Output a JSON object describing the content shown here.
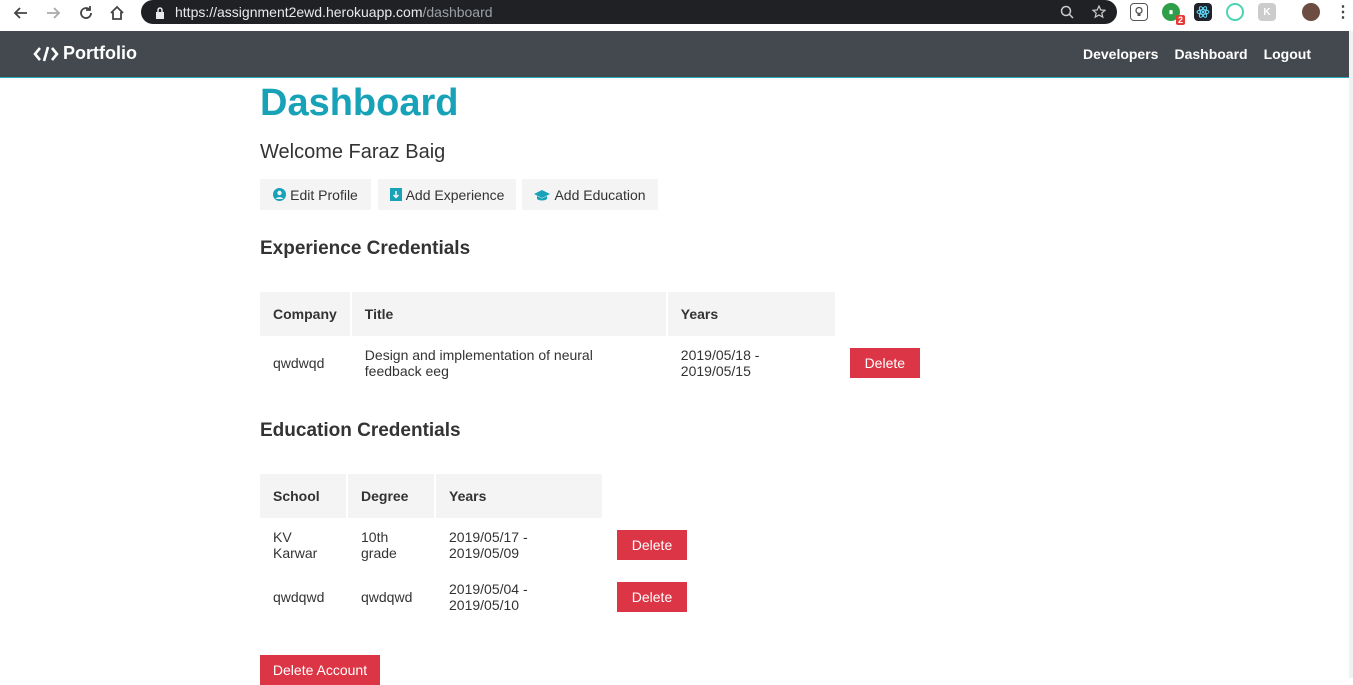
{
  "browser": {
    "url_main": "https://assignment2ewd.herokuapp.com",
    "url_path": "/dashboard",
    "ext_badge": "2"
  },
  "navbar": {
    "brand": "Portfolio",
    "links": [
      "Developers",
      "Dashboard",
      "Logout"
    ]
  },
  "dashboard": {
    "title": "Dashboard",
    "welcome": "Welcome Faraz Baig",
    "actions": {
      "edit_profile": "Edit Profile",
      "add_experience": "Add Experience",
      "add_education": "Add Education"
    }
  },
  "experience": {
    "title": "Experience Credentials",
    "headers": [
      "Company",
      "Title",
      "Years"
    ],
    "rows": [
      {
        "company": "qwdwqd",
        "title": "Design and implementation of neural feedback eeg",
        "years": "2019/05/18 - 2019/05/15",
        "action": "Delete"
      }
    ]
  },
  "education": {
    "title": "Education Credentials",
    "headers": [
      "School",
      "Degree",
      "Years"
    ],
    "rows": [
      {
        "school": "KV Karwar",
        "degree": "10th grade",
        "years": "2019/05/17 - 2019/05/09",
        "action": "Delete"
      },
      {
        "school": "qwdqwd",
        "degree": "qwdqwd",
        "years": "2019/05/04 - 2019/05/10",
        "action": "Delete"
      }
    ]
  },
  "delete_account": "Delete Account",
  "colors": {
    "accent": "#17a2b8",
    "danger": "#dc3545",
    "navbar": "#343a40",
    "light": "#f4f4f4"
  }
}
